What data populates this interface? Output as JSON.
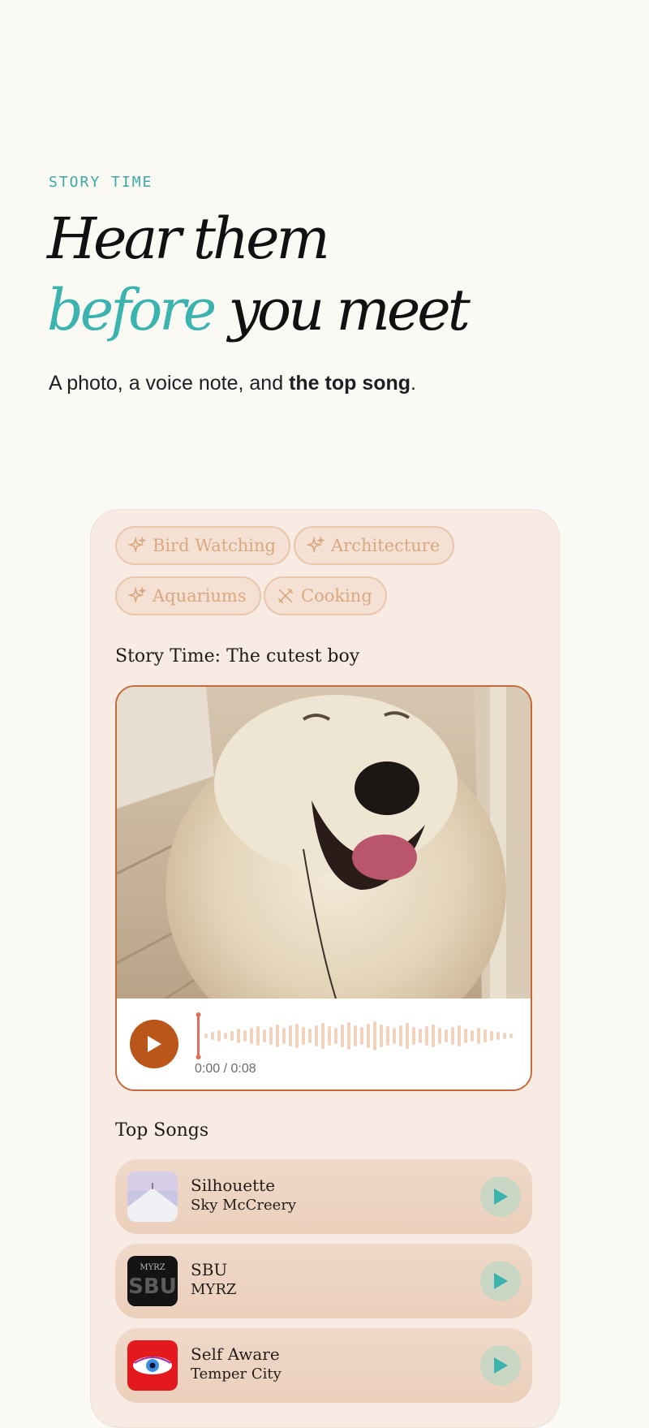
{
  "hero": {
    "eyebrow": "STORY TIME",
    "headline_line1": "Hear them",
    "headline_accent": "before",
    "headline_rest": " you meet",
    "subhead_plain": "A photo, a voice note, and ",
    "subhead_bold": "the top song",
    "subhead_end": "."
  },
  "profile": {
    "interests": [
      {
        "label": "Bird Watching",
        "icon": "sparkle-icon"
      },
      {
        "label": "Architecture",
        "icon": "sparkle-icon"
      },
      {
        "label": "Aquariums",
        "icon": "sparkle-icon"
      },
      {
        "label": "Cooking",
        "icon": "utensils-icon"
      }
    ],
    "story_title": "Story Time: The cutest boy",
    "voice_note": {
      "time": "0:00 / 0:08",
      "progress": 0
    },
    "top_songs_title": "Top Songs",
    "songs": [
      {
        "title": "Silhouette",
        "artist": "Sky McCreery"
      },
      {
        "title": "SBU",
        "artist": "MYRZ",
        "art_text_top": "MYRZ",
        "art_text_main": "SBU"
      },
      {
        "title": "Self Aware",
        "artist": "Temper City"
      }
    ]
  },
  "colors": {
    "accent_teal": "#3bb3af",
    "play_orange": "#bb561b",
    "chip_text": "#d9a880",
    "card_bg": "#f8ebe3"
  }
}
